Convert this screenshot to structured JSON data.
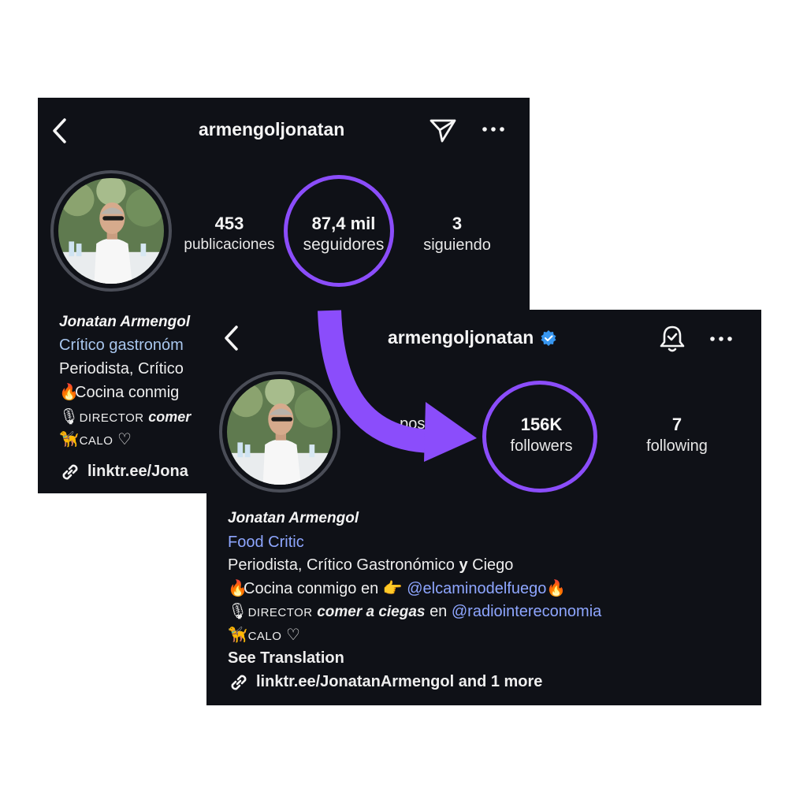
{
  "old_profile": {
    "handle": "armengoljonatan",
    "stats": [
      {
        "number": "453",
        "label": "publicaciones"
      },
      {
        "number": "87,4 mil",
        "label": "seguidores"
      },
      {
        "number": "3",
        "label": "siguiendo"
      }
    ],
    "name": "Jonatan Armengol",
    "category": "Crítico gastronóm",
    "bio_line1": "Periodista, Crítico",
    "bio_line2": "Cocina conmig",
    "bio_line3_caps": "DIRECTOR",
    "bio_line3_bold": "comer",
    "bio_line4": "CALO",
    "link": "linktr.ee/Jona"
  },
  "new_profile": {
    "handle": "armengoljonatan",
    "stats": [
      {
        "number": "",
        "label": "posts"
      },
      {
        "number": "156K",
        "label": "followers"
      },
      {
        "number": "7",
        "label": "following"
      }
    ],
    "name": "Jonatan Armengol",
    "category": "Food Critic",
    "bio_line1_a": "Periodista, Crítico Gastronómico",
    "bio_line1_b": "y",
    "bio_line1_c": "Ciego",
    "bio_line2": "Cocina conmigo en",
    "bio_line2_mention": "@elcaminodelfuego",
    "bio_line3_caps": "DIRECTOR",
    "bio_line3_bold": "comer a ciegas",
    "bio_line3_en": "en",
    "bio_line3_mention": "@radiointereconomia",
    "bio_line4": "CALO",
    "see_translation": "See Translation",
    "link": "linktr.ee/JonatanArmengol and 1 more"
  },
  "icons": {
    "back": "chevron-left-icon",
    "send": "paper-plane-icon",
    "more": "ellipsis-icon",
    "verified": "verified-badge-icon",
    "bell": "bell-check-icon",
    "link": "link-icon",
    "fire": "fire-emoji",
    "mic": "microphone-emoji",
    "dog": "guide-dog-emoji",
    "heart": "white-heart-emoji",
    "point": "pointing-hand-emoji"
  },
  "colors": {
    "panel_bg": "#0f1117",
    "highlight": "#8b4dfb",
    "link_blue": "#8ea6ff"
  }
}
